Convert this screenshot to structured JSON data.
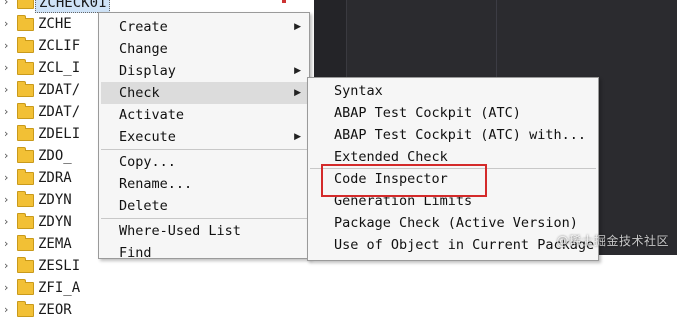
{
  "tree": {
    "selected_index": 0,
    "items": [
      {
        "name": "ZCHECK01"
      },
      {
        "name": "ZCHE"
      },
      {
        "name": "ZCLIF"
      },
      {
        "name": "ZCL_I"
      },
      {
        "name": "ZDAT/"
      },
      {
        "name": "ZDAT/"
      },
      {
        "name": "ZDELI"
      },
      {
        "name": "ZDO_"
      },
      {
        "name": "ZDRA"
      },
      {
        "name": "ZDYN"
      },
      {
        "name": "ZDYN"
      },
      {
        "name": "ZEMA"
      },
      {
        "name": "ZESLI"
      },
      {
        "name": "ZFI_A"
      },
      {
        "name": "ZEOR"
      }
    ]
  },
  "context_menu": {
    "items": [
      {
        "label": "Create",
        "submenu": true
      },
      {
        "label": "Change",
        "submenu": false
      },
      {
        "label": "Display",
        "submenu": true
      },
      {
        "label": "Check",
        "submenu": true,
        "active": true
      },
      {
        "label": "Activate",
        "submenu": false
      },
      {
        "label": "Execute",
        "submenu": true
      },
      {
        "label": "Copy...",
        "submenu": false
      },
      {
        "label": "Rename...",
        "submenu": false
      },
      {
        "label": "Delete",
        "submenu": false
      },
      {
        "label": "Where-Used List",
        "submenu": false
      },
      {
        "label": "Find",
        "submenu": false
      }
    ]
  },
  "check_submenu": {
    "items": [
      {
        "label": "Syntax"
      },
      {
        "label": "ABAP Test Cockpit (ATC)"
      },
      {
        "label": "ABAP Test Cockpit (ATC) with..."
      },
      {
        "label": "Extended Check"
      },
      {
        "label": "Code Inspector",
        "highlighted": true
      },
      {
        "label": "Generation Limits"
      },
      {
        "label": "Package Check (Active Version)"
      },
      {
        "label": "Use of Object in Current Package"
      }
    ]
  },
  "watermark": "@稀土掘金技术社区",
  "colors": {
    "highlight": "#d42a2a",
    "editor_bg": "#2b2b2f",
    "folder": "#f2c035"
  }
}
